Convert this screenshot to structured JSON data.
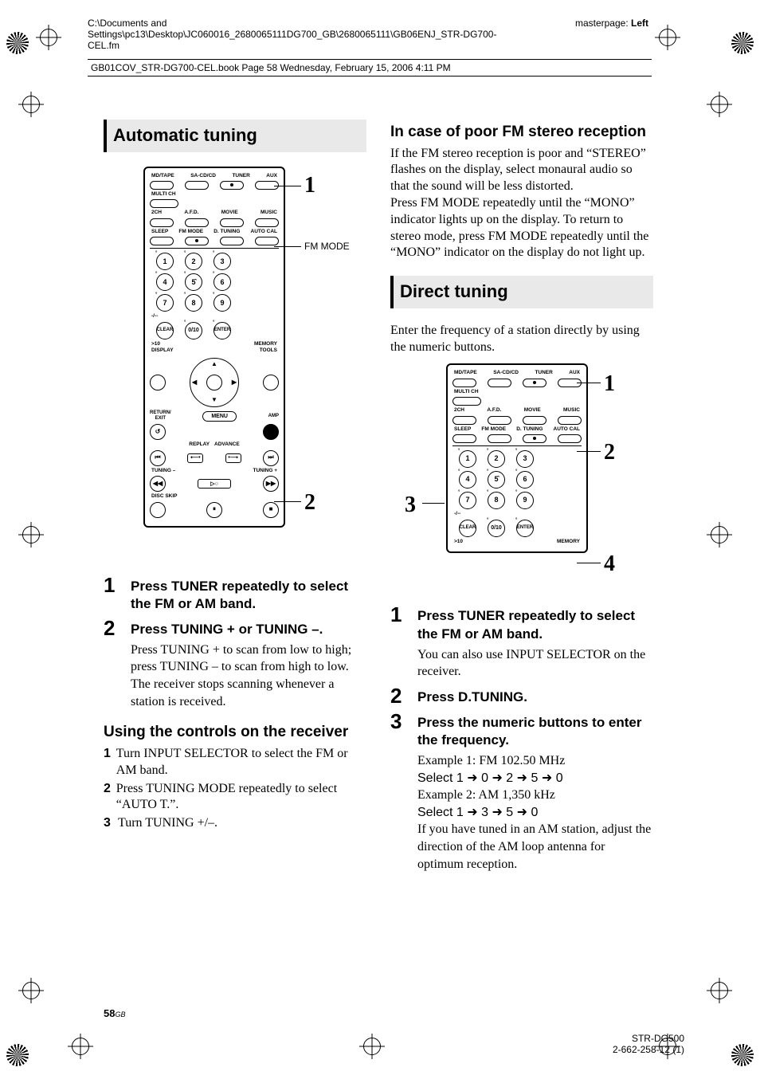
{
  "header": {
    "path": "C:\\Documents and Settings\\pc13\\Desktop\\JC060016_2680065111DG700_GB\\2680065111\\GB06ENJ_STR-DG700-CEL.fm",
    "master_label": "masterpage:",
    "master_value": "Left",
    "bookline": "GB01COV_STR-DG700-CEL.book  Page 58  Wednesday, February 15, 2006  4:11 PM"
  },
  "left": {
    "title": "Automatic tuning",
    "remote_labels": {
      "row1": [
        "MD/TAPE",
        "SA-CD/CD",
        "TUNER",
        "AUX"
      ],
      "multi": "MULTI CH",
      "row2": [
        "2CH",
        "A.F.D.",
        "MOVIE",
        "MUSIC"
      ],
      "row3": [
        "SLEEP",
        "FM MODE",
        "D. TUNING",
        "AUTO CAL"
      ],
      "clear": "CLEAR",
      "zero": "0/10",
      "enter": "ENTER",
      "gt10": ">10",
      "memory": "MEMORY",
      "display": "DISPLAY",
      "tools": "TOOLS",
      "return": "RETURN/\nEXIT",
      "menu": "MENU",
      "amp": "AMP",
      "replay": "REPLAY",
      "advance": "ADVANCE",
      "tuning_minus": "TUNING –",
      "tuning_plus": "TUNING +",
      "disc_skip": "DISC SKIP",
      "dashes": "-/--"
    },
    "callout_fm": "FM MODE",
    "callout_1": "1",
    "callout_2": "2",
    "steps": [
      {
        "n": "1",
        "title": "Press TUNER repeatedly to select the FM or AM band."
      },
      {
        "n": "2",
        "title": "Press TUNING + or TUNING –.",
        "body": "Press TUNING + to scan from low to high; press TUNING – to scan from high to low.\nThe receiver stops scanning whenever a station is received."
      }
    ],
    "controls_title": "Using the controls on the receiver",
    "controls": [
      {
        "n": "1",
        "text": "Turn INPUT SELECTOR to select the FM or AM band."
      },
      {
        "n": "2",
        "text": "Press TUNING MODE repeatedly to select “AUTO T.”."
      },
      {
        "n": "3",
        "text": "Turn TUNING +/–."
      }
    ]
  },
  "right": {
    "poor_title": "In case of poor FM stereo reception",
    "poor_body": "If the FM stereo reception is poor and “STEREO” flashes on the display, select monaural audio so that the sound will be less distorted.\nPress FM MODE repeatedly until the “MONO” indicator lights up on the display. To return to stereo mode, press FM MODE repeatedly until the “MONO” indicator on the display do not light up.",
    "direct_title": "Direct tuning",
    "direct_intro": "Enter the frequency of a station directly by using the numeric buttons.",
    "callout_1": "1",
    "callout_2": "2",
    "callout_3": "3",
    "callout_4": "4",
    "steps": [
      {
        "n": "1",
        "title": "Press TUNER repeatedly to select the FM or AM band.",
        "body": "You can also use INPUT SELECTOR on the receiver."
      },
      {
        "n": "2",
        "title": "Press D.TUNING."
      },
      {
        "n": "3",
        "title": "Press the numeric buttons to enter the frequency.",
        "body_lines": [
          "Example 1: FM 102.50 MHz",
          "Select 1 ➜ 0 ➜ 2 ➜ 5 ➜ 0",
          "Example 2: AM 1,350 kHz",
          "Select 1 ➜ 3 ➜ 5 ➜ 0",
          "If you have tuned in an AM station, adjust the direction of the AM loop antenna for optimum reception."
        ]
      }
    ]
  },
  "footer": {
    "page": "58",
    "gb": "GB",
    "model": "STR-DG500",
    "partno": "2-662-258-12 (1)"
  }
}
